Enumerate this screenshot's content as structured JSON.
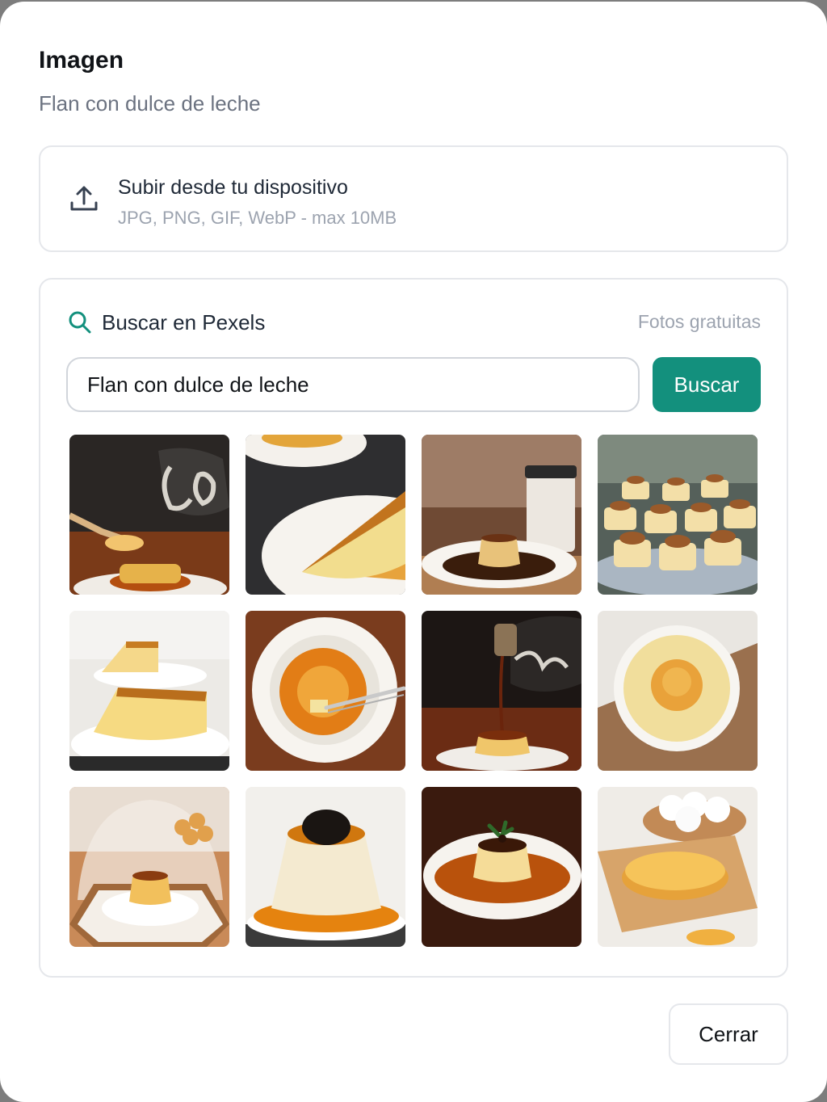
{
  "modal": {
    "title": "Imagen",
    "subtitle": "Flan con dulce de leche"
  },
  "upload": {
    "icon": "upload-icon",
    "title": "Subir desde tu dispositivo",
    "formats": "JPG, PNG, GIF, WebP - max 10MB"
  },
  "pexels": {
    "icon": "search-icon",
    "heading": "Buscar en Pexels",
    "free_label": "Fotos gratuitas",
    "query": "Flan con dulce de leche",
    "button_label": "Buscar",
    "accent_color": "#13907d"
  },
  "results": [
    {
      "name": "result-flan-spoon-cafe"
    },
    {
      "name": "result-flan-slice-plate"
    },
    {
      "name": "result-flan-coffee-cup"
    },
    {
      "name": "result-mini-flans-tray"
    },
    {
      "name": "result-flan-slices-white"
    },
    {
      "name": "result-flan-bowl-fork"
    },
    {
      "name": "result-caramel-pour"
    },
    {
      "name": "result-flan-ramekin"
    },
    {
      "name": "result-flan-glass-dome"
    },
    {
      "name": "result-flan-chocolate-top"
    },
    {
      "name": "result-flan-mint-garnish"
    },
    {
      "name": "result-flan-eggs-board"
    }
  ],
  "footer": {
    "close_label": "Cerrar"
  }
}
